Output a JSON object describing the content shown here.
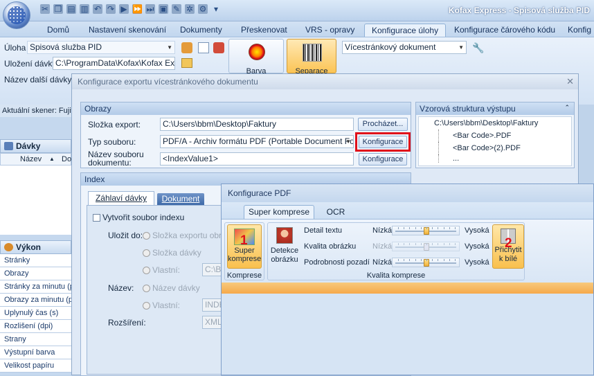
{
  "app": {
    "title": "Kofax Express - Spisová služba PID"
  },
  "tabs": [
    "Domů",
    "Nastavení skenování",
    "Dokumenty",
    "Přeskenovat",
    "VRS - opravy",
    "Konfigurace úlohy",
    "Konfigurace čárového kódu",
    "Konfig"
  ],
  "ribbon": {
    "task_label": "Úloha",
    "task_value": "Spisová služba PID",
    "save_label": "Uložení dávky",
    "save_value": "C:\\ProgramData\\Kofax\\Kofax Ex...",
    "next_label": "Název další dávky",
    "color_label": "Barva",
    "separation_label": "Separace",
    "doctype_value": "Vícestránkový dokument"
  },
  "status": {
    "scanner": "Aktuální skener: Fujitsu"
  },
  "left": {
    "batches_title": "Dávky",
    "col_name": "Název",
    "col_do": "Do",
    "output_title": "Výkon",
    "output_items": [
      "Stránky",
      "Obrazy",
      "Stránky za minutu (p",
      "Obrazy za minutu (p",
      "Uplynulý čas (s)",
      "Rozlišení (dpi)",
      "Strany",
      "Výstupní barva",
      "Velikost papíru"
    ]
  },
  "export_dialog": {
    "title": "Konfigurace exportu vícestránkového dokumentu",
    "images_header": "Obrazy",
    "folder_label": "Složka export:",
    "folder_value": "C:\\Users\\bbm\\Desktop\\Faktury",
    "browse": "Procházet...",
    "type_label": "Typ souboru:",
    "type_value": "PDF/A - Archiv formátu PDF (Portable Document Fo...",
    "config_btn": "Konfigurace",
    "name_label_1": "Název souboru",
    "name_label_2": "dokumentu:",
    "name_value": "<IndexValue1>",
    "config_btn2": "Konfigurace",
    "sample_header": "Vzorová struktura výstupu",
    "tree_root": "C:\\Users\\bbm\\Desktop\\Faktury",
    "tree_items": [
      "<Bar Code>.PDF",
      "<Bar Code>(2).PDF",
      "..."
    ],
    "index_header": "Index",
    "tab_header": "Záhlaví dávky",
    "tab_document": "Dokument",
    "create_index": "Vytvořit soubor indexu",
    "save_to": "Uložit do:",
    "opt_export_folder": "Složka exportu obraz",
    "opt_batch_folder": "Složka dávky",
    "opt_custom": "Vlastní:",
    "custom_path": "C:\\Ba",
    "name_label": "Název:",
    "opt_batch_name": "Název dávky",
    "opt_custom2": "Vlastní:",
    "custom_name": "INDE",
    "ext_label": "Rozšíření:",
    "ext_value": "XML"
  },
  "pdf_dialog": {
    "title": "Konfigurace PDF",
    "tab_super": "Super komprese",
    "tab_ocr": "OCR",
    "super_btn_1": "Super",
    "super_btn_2": "komprese",
    "group_compression": "Komprese",
    "detect_1": "Detekce",
    "detect_2": "obrázku",
    "detail_text": "Detail textu",
    "image_quality": "Kvalita obrázku",
    "bg_detail": "Podrobnosti pozadí",
    "low": "Nízká",
    "high": "Vysoká",
    "stick_1": "Přichytit",
    "stick_2": "k bílé",
    "group_quality": "Kvalita komprese",
    "sliders": [
      0.5,
      0.5,
      0.5
    ]
  },
  "annotations": {
    "n1": "1",
    "n2": "2"
  }
}
